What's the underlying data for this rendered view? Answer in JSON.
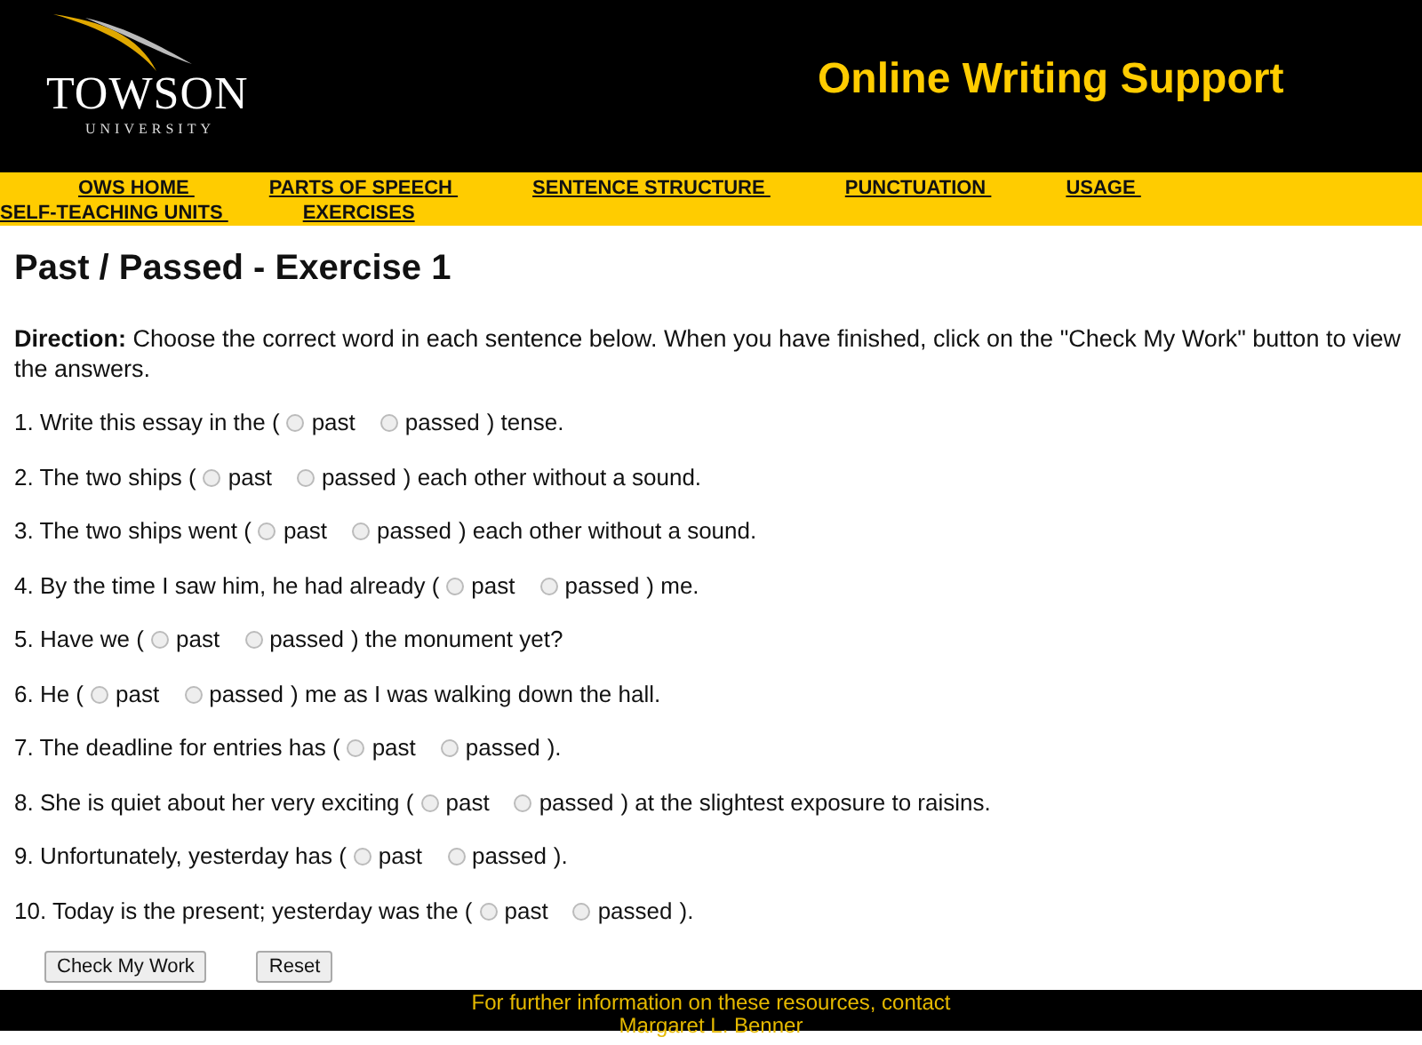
{
  "header": {
    "logo": {
      "name": "TOWSON",
      "subtitle": "UNIVERSITY"
    },
    "title": "Online Writing Support"
  },
  "nav": [
    "OWS HOME ",
    "PARTS OF SPEECH ",
    "SENTENCE STRUCTURE ",
    "PUNCTUATION ",
    "USAGE ",
    "SELF-TEACHING UNITS ",
    "EXERCISES"
  ],
  "heading": "Past / Passed - Exercise 1",
  "direction": "**Direction:** Choose the correct word in each sentence below. When you have finished, click on the \"Check My Work\" button to view the answers.",
  "questions": [
    {
      "before": "1. Write this essay in the (",
      "options": [
        {
          "label": "past",
          "selected": false
        },
        {
          "label": "passed",
          "selected": false
        }
      ],
      "after": ") tense."
    },
    {
      "before": "2. The two ships (",
      "options": [
        {
          "label": "past",
          "selected": false
        },
        {
          "label": "passed",
          "selected": false
        }
      ],
      "after": ") each other without a sound."
    },
    {
      "before": "3. The two ships went (",
      "options": [
        {
          "label": "past",
          "selected": false
        },
        {
          "label": "passed",
          "selected": false
        }
      ],
      "after": ") each other without a sound."
    },
    {
      "before": "4. By the time I saw him, he had already (",
      "options": [
        {
          "label": "past",
          "selected": false
        },
        {
          "label": "passed",
          "selected": false
        }
      ],
      "after": ") me."
    },
    {
      "before": "5. Have we (",
      "options": [
        {
          "label": "past",
          "selected": false
        },
        {
          "label": "passed",
          "selected": false
        }
      ],
      "after": ") the monument yet?"
    },
    {
      "before": "6. He (",
      "options": [
        {
          "label": "past",
          "selected": false
        },
        {
          "label": "passed",
          "selected": false
        }
      ],
      "after": ") me as I was walking down the hall."
    },
    {
      "before": "7. The deadline for entries has (",
      "options": [
        {
          "label": "past",
          "selected": false
        },
        {
          "label": "passed",
          "selected": false
        }
      ],
      "after": ")."
    },
    {
      "before": "8. She is quiet about her very exciting (",
      "options": [
        {
          "label": "past",
          "selected": false
        },
        {
          "label": "passed",
          "selected": false
        }
      ],
      "after": ") at the slightest exposure to raisins."
    },
    {
      "before": "9. Unfortunately, yesterday has (",
      "options": [
        {
          "label": "past",
          "selected": false
        },
        {
          "label": "passed",
          "selected": false
        }
      ],
      "after": ")."
    },
    {
      "before": "10. Today is the present; yesterday was the (",
      "options": [
        {
          "label": "past",
          "selected": false
        },
        {
          "label": "passed",
          "selected": false
        }
      ],
      "after": ")."
    }
  ],
  "buttons": [
    "Check My Work",
    "Reset"
  ],
  "footer": [
    "For further information on these resources, contact",
    "Margaret L. Benner"
  ]
}
